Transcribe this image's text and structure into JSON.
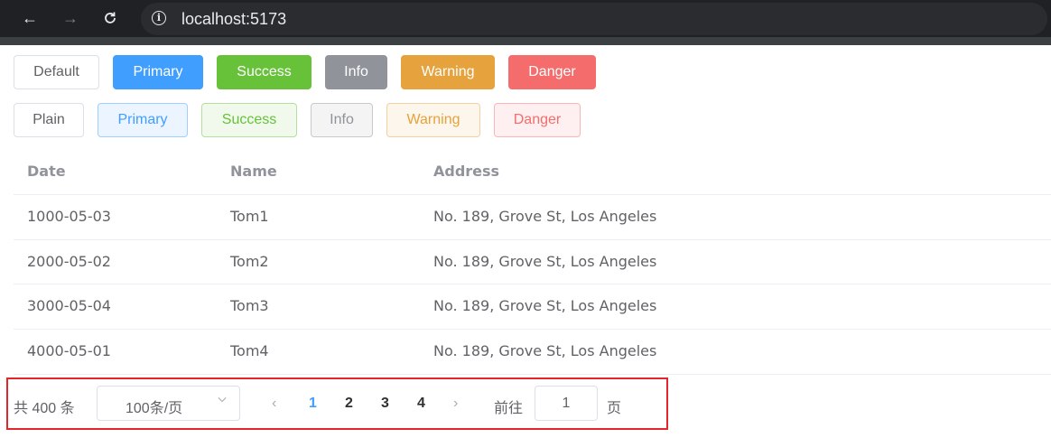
{
  "browser": {
    "url": "localhost:5173",
    "icons": [
      "back-arrow-icon",
      "forward-arrow-icon",
      "reload-icon",
      "info-icon"
    ]
  },
  "buttons": {
    "solid": [
      "Default",
      "Primary",
      "Success",
      "Info",
      "Warning",
      "Danger"
    ],
    "plain": [
      "Plain",
      "Primary",
      "Success",
      "Info",
      "Warning",
      "Danger"
    ]
  },
  "colors": {
    "primary": "#409eff",
    "success": "#67c23a",
    "info": "#909399",
    "warning": "#e6a23c",
    "danger": "#f56c6c",
    "highlight_border": "#e3262b"
  },
  "table": {
    "headers": [
      "Date",
      "Name",
      "Address"
    ],
    "rows": [
      [
        "1000-05-03",
        "Tom1",
        "No. 189, Grove St, Los Angeles"
      ],
      [
        "2000-05-02",
        "Tom2",
        "No. 189, Grove St, Los Angeles"
      ],
      [
        "3000-05-04",
        "Tom3",
        "No. 189, Grove St, Los Angeles"
      ],
      [
        "4000-05-01",
        "Tom4",
        "No. 189, Grove St, Los Angeles"
      ]
    ]
  },
  "pagination": {
    "total": "共 400 条",
    "page_size": "100条/页",
    "prev": "‹",
    "next": "›",
    "pages": [
      "1",
      "2",
      "3",
      "4"
    ],
    "current": "1",
    "goto_label": "前往",
    "goto_value": "1",
    "page_suffix": "页"
  }
}
